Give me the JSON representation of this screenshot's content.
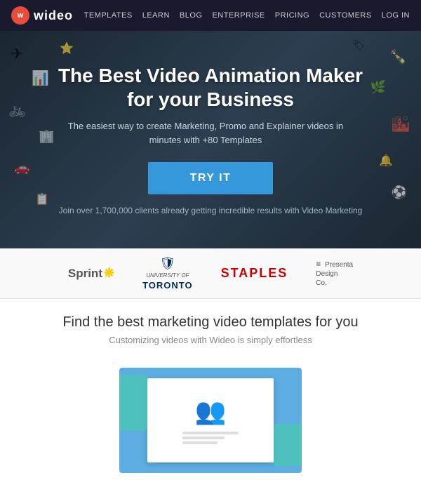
{
  "nav": {
    "logo_letter": "w",
    "logo_text": "wideo",
    "links": [
      "TEMPLATES",
      "LEARN",
      "BLOG",
      "ENTERPRISE",
      "PRICING",
      "CUSTOMERS",
      "LOG IN"
    ]
  },
  "hero": {
    "title_line1": "The Best Video Animation Maker",
    "title_line2": "for your Business",
    "subtitle": "The easiest way to create Marketing, Promo and Explainer videos in minutes with +80 Templates",
    "cta_label": "TRY IT",
    "social_proof": "Join over 1,700,000 clients already getting incredible results with Video Marketing",
    "bg_color": "#2c3e50",
    "cta_color": "#3498db"
  },
  "brands": {
    "label1": "Sprint",
    "label2_line1": "UNIVERSITY OF",
    "label2_line2": "TORONTO",
    "label3": "STAPLES",
    "label4_line1": "Presenta",
    "label4_line2": "Design",
    "label4_line3": "Co."
  },
  "find_section": {
    "title": "Find the best marketing video templates for you",
    "subtitle": "Customizing videos with Wideo is simply effortless"
  },
  "decorative_icons": [
    "✈",
    "🚲",
    "📊",
    "🏙",
    "🚗",
    "🍾",
    "⚽",
    "🌿",
    "🔔",
    "📋"
  ]
}
